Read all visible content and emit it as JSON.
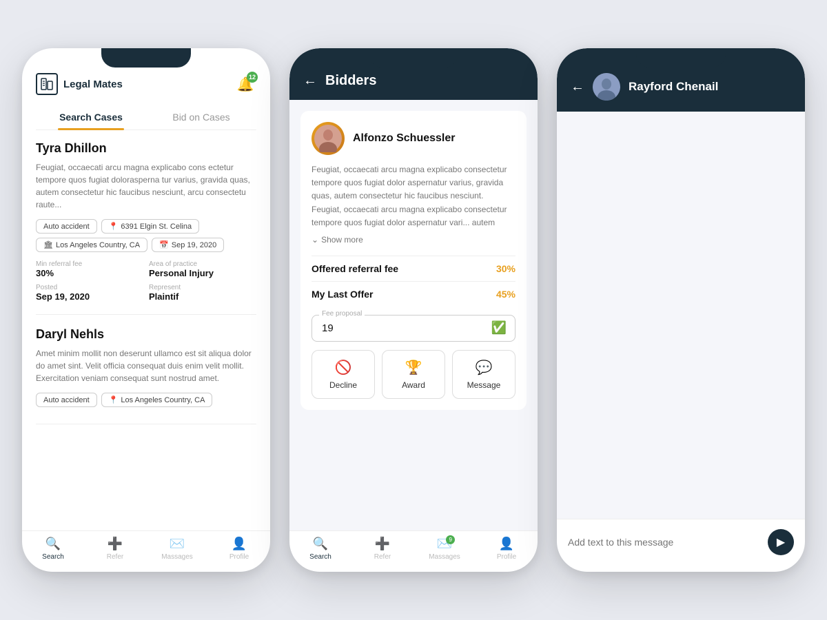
{
  "app": {
    "name": "Legal Mates",
    "notif_count": "12"
  },
  "phone1": {
    "tabs": [
      {
        "label": "Search Cases",
        "active": true
      },
      {
        "label": "Bid on Cases",
        "active": false
      }
    ],
    "cases": [
      {
        "name": "Tyra Dhillon",
        "desc": "Feugiat, occaecati arcu magna explicabo cons ectetur tempore quos fugiat dolorasperna tur varius, gravida quas, autem consectetur hic faucibus nesciunt, arcu consectetu raute...",
        "tags": [
          "Auto accident",
          "6391 Elgin St. Celina"
        ],
        "tags2": [
          "Los Angeles Country, CA",
          "Sep 19, 2020"
        ],
        "meta": [
          {
            "label": "Min referral fee",
            "value": "30%"
          },
          {
            "label": "Area of practice",
            "value": "Personal Injury"
          },
          {
            "label": "Posted",
            "value": "Sep 19, 2020"
          },
          {
            "label": "Represent",
            "value": "Plaintif"
          }
        ]
      },
      {
        "name": "Daryl Nehls",
        "desc": "Amet minim mollit non deserunt ullamco est sit aliqua dolor do amet sint. Velit officia consequat duis enim velit mollit. Exercitation veniam consequat sunt nostrud amet.",
        "tags": [
          "Auto accident",
          "Los Angeles Country, CA"
        ],
        "tags2": [],
        "meta": []
      }
    ],
    "navbar": [
      {
        "label": "Search",
        "active": true
      },
      {
        "label": "Refer",
        "active": false
      },
      {
        "label": "Massages",
        "active": false
      },
      {
        "label": "Profile",
        "active": false
      }
    ]
  },
  "phone2": {
    "header": "Bidders",
    "bidder": {
      "name": "Alfonzo Schuessler",
      "desc": "Feugiat, occaecati arcu magna explicabo consectetur tempore quos fugiat dolor aspernatur varius, gravida quas, autem consectetur hic faucibus nesciunt. Feugiat, occaecati arcu magna explicabo consectetur tempore quos fugiat dolor aspernatur vari... autem",
      "show_more": "Show more",
      "offered_fee_label": "Offered referral fee",
      "offered_fee_value": "30%",
      "my_last_offer_label": "My Last Offer",
      "my_last_offer_value": "45%",
      "fee_proposal_label": "Fee proposal",
      "fee_proposal_value": "19",
      "actions": [
        {
          "label": "Decline",
          "icon": "decline"
        },
        {
          "label": "Award",
          "icon": "award"
        },
        {
          "label": "Message",
          "icon": "message"
        }
      ]
    },
    "navbar": [
      {
        "label": "Search",
        "active": true
      },
      {
        "label": "Refer",
        "active": false
      },
      {
        "label": "Massages",
        "active": false,
        "badge": "9"
      },
      {
        "label": "Profile",
        "active": false
      }
    ]
  },
  "phone3": {
    "user_name": "Rayford Chenail",
    "message_placeholder": "Add text to this message"
  }
}
